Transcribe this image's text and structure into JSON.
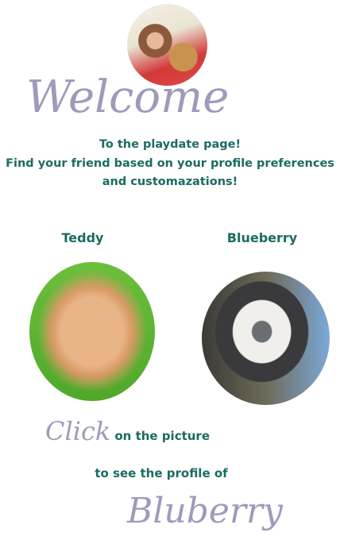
{
  "header": {
    "avatar_alt": "profile-photo"
  },
  "welcome": {
    "title": "Welcome",
    "lines": [
      "To the playdate page!",
      "Find your friend based on your profile preferences",
      "and customazations!"
    ]
  },
  "dogs": [
    {
      "name": "Teddy"
    },
    {
      "name": "Blueberry"
    }
  ],
  "footer": {
    "click_word": "Click",
    "click_rest": "on the picture",
    "line2": "to see the profile of",
    "dog_name": "Bluberry"
  },
  "colors": {
    "accent": "#1b6b63",
    "script": "#9f9abb"
  }
}
